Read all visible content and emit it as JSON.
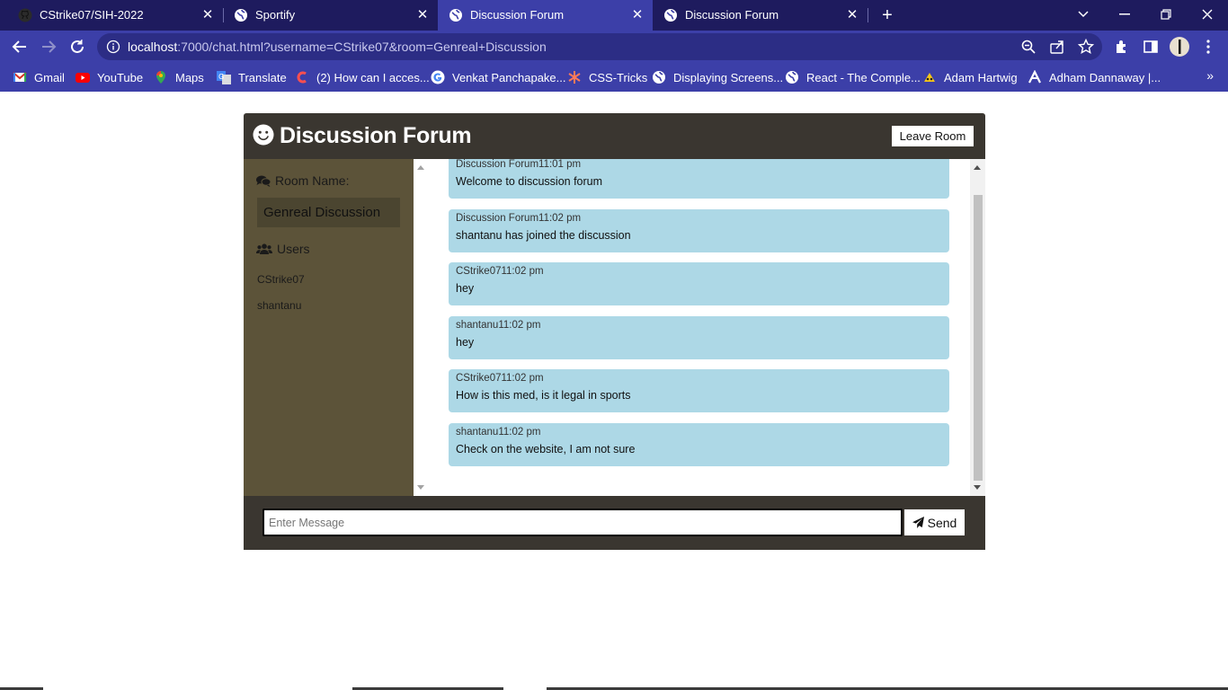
{
  "browser": {
    "tabs": [
      {
        "title": "CStrike07/SIH-2022",
        "icon": "github-icon",
        "active": false
      },
      {
        "title": "Sportify",
        "icon": "globe-icon",
        "active": false
      },
      {
        "title": "Discussion Forum",
        "icon": "globe-icon",
        "active": true
      },
      {
        "title": "Discussion Forum",
        "icon": "globe-icon",
        "active": false
      }
    ],
    "url_host": "localhost",
    "url_rest": ":7000/chat.html?username=CStrike07&room=Genreal+Discussion",
    "bookmarks": [
      {
        "label": "Gmail",
        "icon": "gmail-icon"
      },
      {
        "label": "YouTube",
        "icon": "youtube-icon"
      },
      {
        "label": "Maps",
        "icon": "maps-icon"
      },
      {
        "label": "Translate",
        "icon": "translate-icon"
      },
      {
        "label": "(2) How can I acces...",
        "icon": "coursera-icon"
      },
      {
        "label": "Venkat Panchapake...",
        "icon": "google-icon"
      },
      {
        "label": "CSS-Tricks",
        "icon": "css-tricks-icon"
      },
      {
        "label": "Displaying Screens...",
        "icon": "globe-icon"
      },
      {
        "label": "React - The Comple...",
        "icon": "globe-icon"
      },
      {
        "label": "Adam Hartwig",
        "icon": "adam-icon"
      },
      {
        "label": "Adham Dannaway |...",
        "icon": "adham-icon"
      }
    ],
    "colors": {
      "tabstrip": "#1e1b5e",
      "toolbar": "#3c3fa8"
    }
  },
  "forum": {
    "brand": "Discussion Forum",
    "leave_label": "Leave Room",
    "room_name_label": "Room Name:",
    "room_name": "Genreal Discussion",
    "users_label": "Users",
    "users": [
      "CStrike07",
      "shantanu"
    ],
    "messages": [
      {
        "meta": "Discussion Forum11:01 pm",
        "text": "Welcome to discussion forum"
      },
      {
        "meta": "Discussion Forum11:02 pm",
        "text": "shantanu has joined the discussion"
      },
      {
        "meta": "CStrike0711:02 pm",
        "text": "hey"
      },
      {
        "meta": "shantanu11:02 pm",
        "text": "hey"
      },
      {
        "meta": "CStrike0711:02 pm",
        "text": "How is this med, is it legal in sports"
      },
      {
        "meta": "shantanu11:02 pm",
        "text": "Check on the website, I am not sure"
      }
    ],
    "input_placeholder": "Enter Message",
    "send_label": "Send",
    "colors": {
      "header": "#3a3630",
      "sidebar": "#5c5339",
      "message_bg": "#add8e6"
    }
  }
}
